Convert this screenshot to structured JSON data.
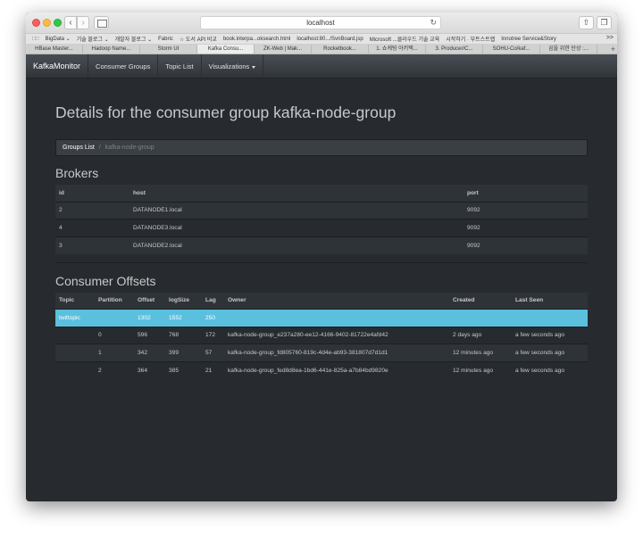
{
  "browser": {
    "url": "localhost",
    "bookmarks": [
      "BigData ⌄",
      "기술 블로그 ⌄",
      "개발자 블로그 ⌄",
      "Fabric",
      "☆ 도서 API 비교",
      "book.interpa...oksearch.html",
      "localhost:80.../SvnBoard.jsp",
      "Microsoft ...클라우드 기술 교육",
      "시작하기 · 부트스트랩",
      "Innotree Service&Story"
    ],
    "bookmarks_more": ">>",
    "tabs": [
      "HBase Master...",
      "Hadoop Name...",
      "Storm UI",
      "Kafka Consu...",
      "ZK-Web | Mak...",
      "Rocketbook...",
      "1. 쇼케팅 아키텍...",
      "3. Producer/C...",
      "SOHU-Co/kaf...",
      "곰을 위한 단상 :..."
    ],
    "active_tab_index": 3
  },
  "navbar": {
    "brand": "KafkaMonitor",
    "links": [
      "Consumer Groups",
      "Topic List",
      "Visualizations"
    ]
  },
  "page": {
    "title": "Details for the consumer group kafka-node-group",
    "breadcrumb": {
      "root": "Groups List",
      "separator": "/",
      "current": "kafka-node-group"
    }
  },
  "brokers": {
    "title": "Brokers",
    "columns": [
      "id",
      "host",
      "port"
    ],
    "rows": [
      [
        "2",
        "DATANODE1.local",
        "9092"
      ],
      [
        "4",
        "DATANODE3.local",
        "9092"
      ],
      [
        "3",
        "DATANODE2.local",
        "9092"
      ]
    ]
  },
  "offsets": {
    "title": "Consumer Offsets",
    "columns": [
      "Topic",
      "Partition",
      "Offset",
      "logSize",
      "Lag",
      "Owner",
      "Created",
      "Last Seen"
    ],
    "topic_row": [
      "twittopic",
      "",
      "1302",
      "1552",
      "250",
      "",
      "",
      ""
    ],
    "rows": [
      [
        "",
        "0",
        "596",
        "768",
        "172",
        "kafka-node-group_e237a280-ee12-4166-9402-81722e4afd42",
        "2 days ago",
        "a few seconds ago"
      ],
      [
        "",
        "1",
        "342",
        "399",
        "57",
        "kafka-node-group_fd805760-819c-4d4e-ab93-381807d7d1d1",
        "12 minutes ago",
        "a few seconds ago"
      ],
      [
        "",
        "2",
        "364",
        "385",
        "21",
        "kafka-node-group_fed8d8ea-1bd6-441e-825a-a7b84bd9820e",
        "12 minutes ago",
        "a few seconds ago"
      ]
    ]
  },
  "colors": {
    "background": "#272b30",
    "navbar": "#3a3f44",
    "highlight_row": "#5bc0de",
    "text": "#c8c8c8"
  }
}
